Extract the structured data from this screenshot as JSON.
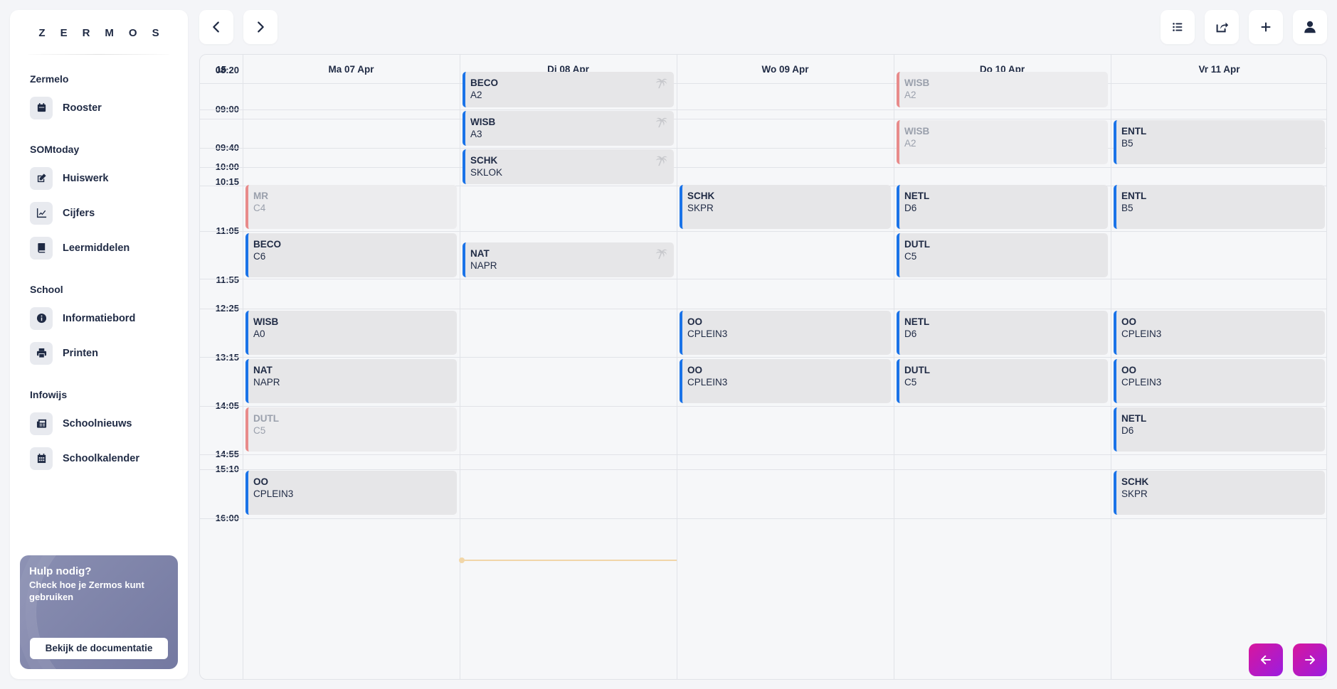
{
  "sidebar": {
    "logo": "ZERMOS",
    "sections": [
      {
        "title": "Zermelo",
        "items": [
          {
            "label": "Rooster",
            "icon": "calendar-icon"
          }
        ]
      },
      {
        "title": "SOMtoday",
        "items": [
          {
            "label": "Huiswerk",
            "icon": "edit-icon"
          },
          {
            "label": "Cijfers",
            "icon": "chart-line-icon"
          },
          {
            "label": "Leermiddelen",
            "icon": "book-icon"
          }
        ]
      },
      {
        "title": "School",
        "items": [
          {
            "label": "Informatiebord",
            "icon": "info-icon"
          },
          {
            "label": "Printen",
            "icon": "printer-icon"
          }
        ]
      },
      {
        "title": "Infowijs",
        "items": [
          {
            "label": "Schoolnieuws",
            "icon": "newspaper-icon"
          },
          {
            "label": "Schoolkalender",
            "icon": "calendar-grid-icon"
          }
        ]
      }
    ],
    "help": {
      "title": "Hulp nodig?",
      "subtitle": "Check hoe je Zermos kunt gebruiken",
      "button": "Bekijk de documentatie"
    }
  },
  "calendar": {
    "week_number": "15",
    "days": [
      "Ma 07 Apr",
      "Di 08 Apr",
      "Wo 09 Apr",
      "Do 10 Apr",
      "Vr 11 Apr"
    ],
    "times": [
      "08:20",
      "09:00",
      "09:40",
      "10:00",
      "10:15",
      "11:05",
      "11:55",
      "12:25",
      "13:15",
      "14:05",
      "14:55",
      "15:10",
      "16:00"
    ],
    "lessons": [
      {
        "day": 0,
        "slot": 3,
        "subject": "MR",
        "room": "C4",
        "cancelled": true
      },
      {
        "day": 0,
        "slot": 4,
        "subject": "BECO",
        "room": "C6"
      },
      {
        "day": 0,
        "slot": 5,
        "subject": "WISB",
        "room": "A0"
      },
      {
        "day": 0,
        "slot": 6,
        "subject": "NAT",
        "room": "NAPR"
      },
      {
        "day": 0,
        "slot": 7,
        "subject": "DUTL",
        "room": "C5",
        "cancelled": true
      },
      {
        "day": 0,
        "slot": 8,
        "subject": "OO",
        "room": "CPLEIN3"
      },
      {
        "day": 1,
        "slot": 0,
        "subject": "BECO",
        "room": "A2",
        "palm": true
      },
      {
        "day": 1,
        "slot": 1,
        "subject": "WISB",
        "room": "A3",
        "palm": true
      },
      {
        "day": 1,
        "slot": 2,
        "subject": "SCHK",
        "room": "SKLOK",
        "palm": true
      },
      {
        "day": 1,
        "slot": 9,
        "subject": "NAT",
        "room": "NAPR",
        "palm": true
      },
      {
        "day": 2,
        "slot": 3,
        "subject": "SCHK",
        "room": "SKPR"
      },
      {
        "day": 2,
        "slot": 5,
        "subject": "OO",
        "room": "CPLEIN3"
      },
      {
        "day": 2,
        "slot": 6,
        "subject": "OO",
        "room": "CPLEIN3"
      },
      {
        "day": 3,
        "slot": 0,
        "subject": "WISB",
        "room": "A2",
        "cancelled": true
      },
      {
        "day": 3,
        "slot": 10,
        "subject": "WISB",
        "room": "A2",
        "cancelled": true
      },
      {
        "day": 3,
        "slot": 3,
        "subject": "NETL",
        "room": "D6"
      },
      {
        "day": 3,
        "slot": 4,
        "subject": "DUTL",
        "room": "C5"
      },
      {
        "day": 3,
        "slot": 5,
        "subject": "NETL",
        "room": "D6"
      },
      {
        "day": 3,
        "slot": 6,
        "subject": "DUTL",
        "room": "C5"
      },
      {
        "day": 4,
        "slot": 10,
        "subject": "ENTL",
        "room": "B5"
      },
      {
        "day": 4,
        "slot": 3,
        "subject": "ENTL",
        "room": "B5"
      },
      {
        "day": 4,
        "slot": 5,
        "subject": "OO",
        "room": "CPLEIN3"
      },
      {
        "day": 4,
        "slot": 6,
        "subject": "OO",
        "room": "CPLEIN3"
      },
      {
        "day": 4,
        "slot": 7,
        "subject": "NETL",
        "room": "D6"
      },
      {
        "day": 4,
        "slot": 8,
        "subject": "SCHK",
        "room": "SKPR"
      }
    ]
  },
  "colors": {
    "accent": "#1a73e8",
    "cancelled": "#e88b8b",
    "gradient_start": "#d7169d",
    "gradient_end": "#9b1de0"
  }
}
